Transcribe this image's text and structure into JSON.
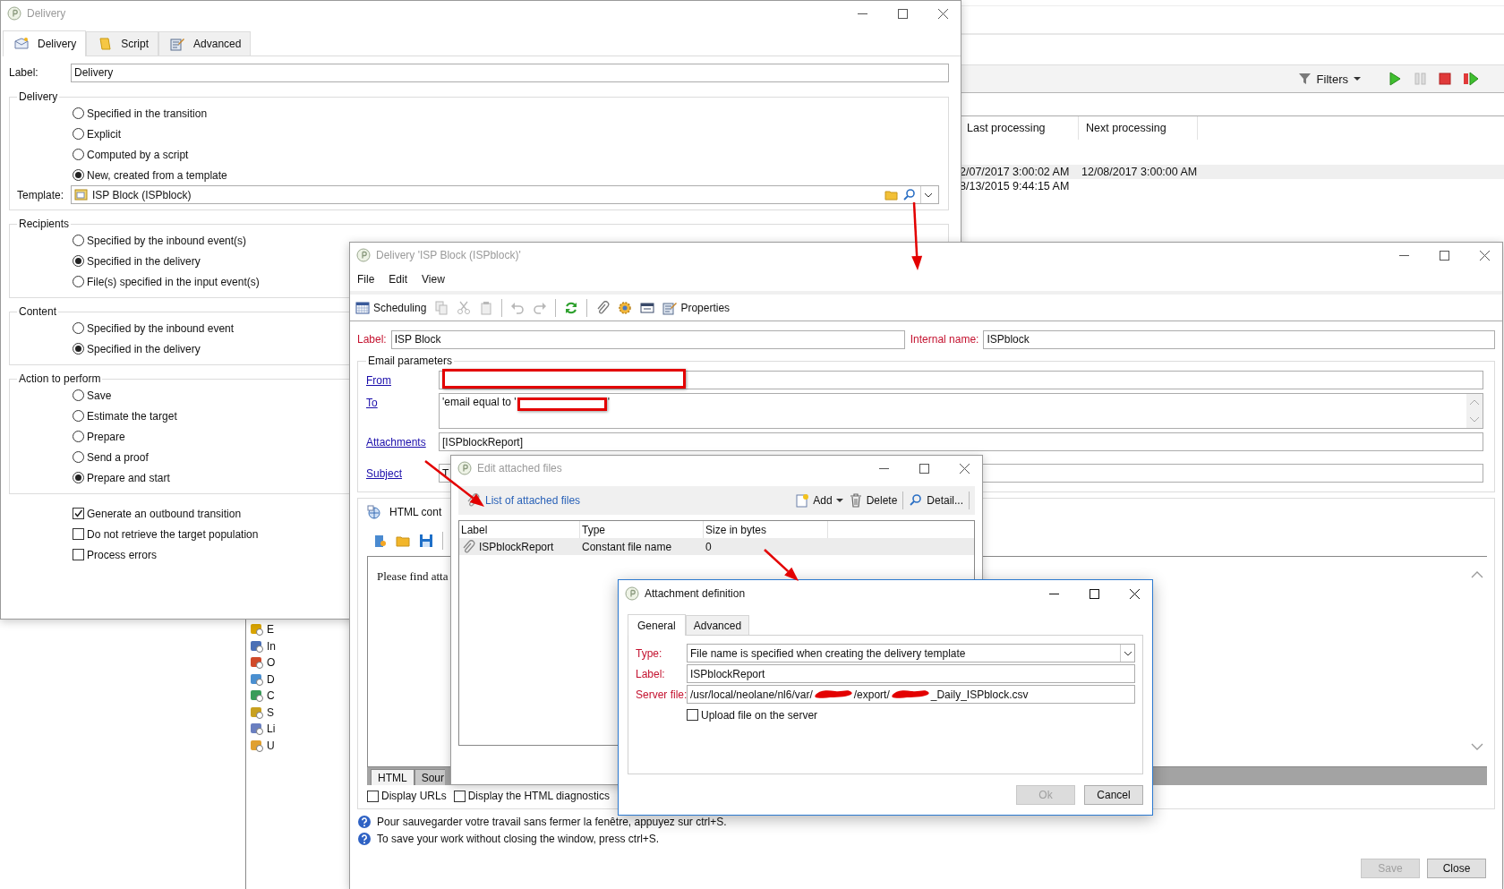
{
  "background_window": {
    "filters_label": "Filters",
    "columns": [
      {
        "label": "Last processing"
      },
      {
        "label": "Next processing"
      }
    ],
    "rows": [
      {
        "cells": [
          "2/07/2017 3:00:02 AM",
          "12/08/2017 3:00:00 AM"
        ],
        "selected": true
      },
      {
        "cells": [
          "8/13/2015 9:44:15 AM"
        ],
        "selected": false
      }
    ],
    "tree_items": [
      {
        "label": "E"
      },
      {
        "label": "In"
      },
      {
        "label": "O"
      },
      {
        "label": "D"
      },
      {
        "label": "C"
      },
      {
        "label": "S"
      },
      {
        "label": "Li"
      },
      {
        "label": "U"
      }
    ]
  },
  "delivery_window": {
    "title": "Delivery",
    "tabs": [
      {
        "label": "Delivery",
        "selected": true
      },
      {
        "label": "Script",
        "selected": false
      },
      {
        "label": "Advanced",
        "selected": false
      }
    ],
    "label_field": {
      "label": "Label:",
      "value": "Delivery"
    },
    "groups": [
      {
        "title": "Delivery",
        "options": [
          {
            "label": "Specified in the transition",
            "selected": false
          },
          {
            "label": "Explicit",
            "selected": false
          },
          {
            "label": "Computed by a script",
            "selected": false
          },
          {
            "label": "New, created from a template",
            "selected": true
          }
        ],
        "template": {
          "label": "Template:",
          "value": "ISP Block (ISPblock)"
        }
      },
      {
        "title": "Recipients",
        "options": [
          {
            "label": "Specified by the inbound event(s)",
            "selected": false
          },
          {
            "label": "Specified in the delivery",
            "selected": true
          },
          {
            "label": "File(s) specified in the input event(s)",
            "selected": false
          }
        ]
      },
      {
        "title": "Content",
        "options": [
          {
            "label": "Specified by the inbound event",
            "selected": false
          },
          {
            "label": "Specified in the delivery",
            "selected": true
          }
        ]
      },
      {
        "title": "Action to perform",
        "options": [
          {
            "label": "Save",
            "selected": false
          },
          {
            "label": "Estimate the target",
            "selected": false
          },
          {
            "label": "Prepare",
            "selected": false
          },
          {
            "label": "Send a proof",
            "selected": false
          },
          {
            "label": "Prepare and start",
            "selected": true
          }
        ]
      }
    ],
    "checkboxes": [
      {
        "label": "Generate an outbound transition",
        "checked": true
      },
      {
        "label": "Do not retrieve the target population",
        "checked": false
      },
      {
        "label": "Process errors",
        "checked": false
      }
    ]
  },
  "delivery_editor": {
    "title": "Delivery 'ISP Block (ISPblock)'",
    "menu": [
      "File",
      "Edit",
      "View"
    ],
    "toolbar_buttons": [
      "Scheduling",
      "Properties"
    ],
    "label": {
      "label": "Label:",
      "value": "ISP Block"
    },
    "internal_name": {
      "label": "Internal name:",
      "value": "ISPblock"
    },
    "email_parameters": {
      "title": "Email parameters",
      "rows": [
        {
          "kind": "text",
          "label": "From",
          "redacted": true
        },
        {
          "kind": "multiline",
          "label": "To",
          "value_before": "'email equal to '",
          "value_after": "'",
          "redacted": true
        },
        {
          "kind": "text",
          "label": "Attachments",
          "value": "[ISPblockReport]",
          "redacted": false
        },
        {
          "kind": "text",
          "label": "Subject",
          "value": "T",
          "redacted": false
        }
      ]
    },
    "html_content": {
      "title": "HTML cont",
      "body": "Please find atta",
      "tabs": [
        {
          "label": "HTML",
          "selected": true
        },
        {
          "label": "Sour",
          "selected": false
        }
      ],
      "options": [
        {
          "label": "Display URLs",
          "checked": false
        },
        {
          "label": "Display the HTML diagnostics",
          "checked": false
        }
      ]
    },
    "help": [
      "Pour sauvegarder votre travail sans fermer la fenêtre, appuyez sur ctrl+S.",
      "To save your work without closing the window, press ctrl+S."
    ],
    "buttons": [
      {
        "label": "Save",
        "disabled": true
      },
      {
        "label": "Close",
        "disabled": false
      }
    ]
  },
  "attached_files_window": {
    "title": "Edit attached files",
    "list_title": "List of attached files",
    "toolbar": [
      "Add",
      "Delete",
      "Detail..."
    ],
    "columns": [
      "Label",
      "Type",
      "Size in bytes"
    ],
    "rows": [
      {
        "cells": [
          "ISPblockReport",
          "Constant file name",
          "0"
        ],
        "selected": true
      }
    ]
  },
  "attachment_definition": {
    "title": "Attachment definition",
    "tabs": [
      {
        "label": "General",
        "selected": true
      },
      {
        "label": "Advanced",
        "selected": false
      }
    ],
    "fields": [
      {
        "kind": "dropdown",
        "label": "Type:",
        "value": "File name is specified when creating the delivery template"
      },
      {
        "kind": "text",
        "label": "Label:",
        "value": "ISPblockReport"
      },
      {
        "kind": "path",
        "label": "Server file:",
        "parts": [
          "/usr/local/neolane/nl6/var/",
          "/export/",
          "_Daily_ISPblock.csv"
        ]
      }
    ],
    "upload": {
      "label": "Upload file on the server",
      "checked": false
    },
    "buttons": [
      {
        "label": "Ok",
        "disabled": true
      },
      {
        "label": "Cancel",
        "disabled": false
      }
    ]
  }
}
